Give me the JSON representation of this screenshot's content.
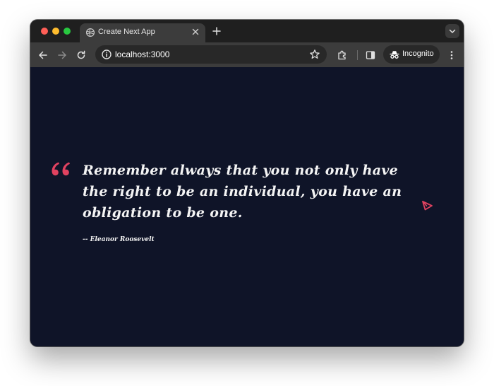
{
  "tab": {
    "title": "Create Next App",
    "favicon": "globe-icon"
  },
  "toolbar": {
    "url": "localhost:3000",
    "incognito_label": "Incognito"
  },
  "quote": {
    "text": "Remember always that you not only have the right to be an individual, you have an obligation to be one.",
    "author": "-- Eleanor Roosevelt"
  },
  "colors": {
    "accent": "#e04260",
    "page_background": "#0f1428",
    "text": "#f4f4f4"
  },
  "icons": {
    "quote": "quotation-mark-icon",
    "action": "send-arrow-icon"
  }
}
